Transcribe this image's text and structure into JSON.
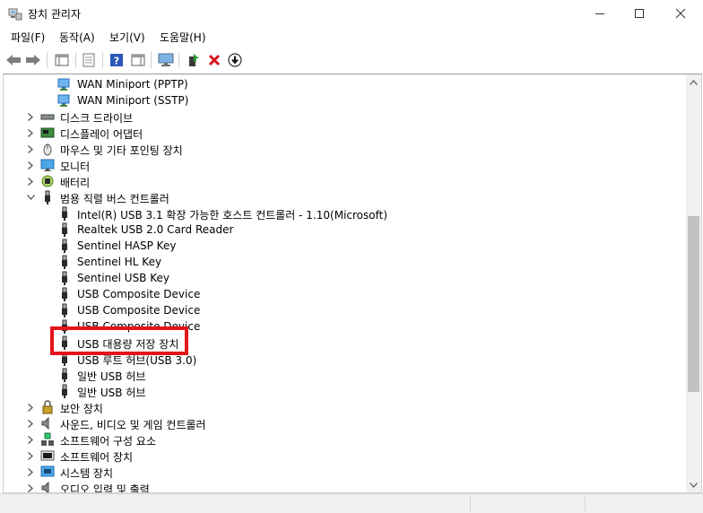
{
  "window": {
    "title": "장치 관리자",
    "icons": {
      "app": "device-manager-icon",
      "minimize": "minimize-icon",
      "maximize": "maximize-icon",
      "close": "close-icon"
    }
  },
  "menu": [
    {
      "label": "파일(F)"
    },
    {
      "label": "동작(A)"
    },
    {
      "label": "보기(V)"
    },
    {
      "label": "도움말(H)"
    }
  ],
  "toolbar": [
    {
      "name": "back-icon"
    },
    {
      "name": "forward-icon"
    },
    {
      "name": "show-hide-console-tree-icon"
    },
    {
      "name": "properties-icon"
    },
    {
      "name": "help-icon"
    },
    {
      "name": "action-pane-icon"
    },
    {
      "name": "scan-hardware-icon"
    },
    {
      "name": "update-driver-icon"
    },
    {
      "name": "uninstall-device-icon"
    },
    {
      "name": "disable-device-icon"
    }
  ],
  "tree": [
    {
      "label": "WAN Miniport (PPTP)",
      "level": 2,
      "icon": "network-adapter-icon"
    },
    {
      "label": "WAN Miniport (SSTP)",
      "level": 2,
      "icon": "network-adapter-icon"
    },
    {
      "label": "디스크 드라이브",
      "level": 1,
      "icon": "disk-drive-icon",
      "expanded": false
    },
    {
      "label": "디스플레이 어댑터",
      "level": 1,
      "icon": "display-adapter-icon",
      "expanded": false
    },
    {
      "label": "마우스 및 기타 포인팅 장치",
      "level": 1,
      "icon": "mouse-icon",
      "expanded": false
    },
    {
      "label": "모니터",
      "level": 1,
      "icon": "monitor-icon",
      "expanded": false
    },
    {
      "label": "배터리",
      "level": 1,
      "icon": "battery-icon",
      "expanded": false
    },
    {
      "label": "범용 직렬 버스 컨트롤러",
      "level": 1,
      "icon": "usb-controller-icon",
      "expanded": true
    },
    {
      "label": "Intel(R) USB 3.1 확장 가능한 호스트 컨트롤러 - 1.10(Microsoft)",
      "level": 2,
      "icon": "usb-device-icon"
    },
    {
      "label": "Realtek USB 2.0 Card Reader",
      "level": 2,
      "icon": "usb-device-icon"
    },
    {
      "label": "Sentinel HASP Key",
      "level": 2,
      "icon": "usb-device-icon"
    },
    {
      "label": "Sentinel HL Key",
      "level": 2,
      "icon": "usb-device-icon"
    },
    {
      "label": "Sentinel USB Key",
      "level": 2,
      "icon": "usb-device-icon"
    },
    {
      "label": "USB Composite Device",
      "level": 2,
      "icon": "usb-device-icon"
    },
    {
      "label": "USB Composite Device",
      "level": 2,
      "icon": "usb-device-icon"
    },
    {
      "label": "USB Composite Device",
      "level": 2,
      "icon": "usb-device-icon"
    },
    {
      "label": "USB 대용량 저장 장치",
      "level": 2,
      "icon": "usb-device-icon",
      "highlighted": true
    },
    {
      "label": "USB 루트 허브(USB 3.0)",
      "level": 2,
      "icon": "usb-device-icon"
    },
    {
      "label": "일반 USB 허브",
      "level": 2,
      "icon": "usb-device-icon"
    },
    {
      "label": "일반 USB 허브",
      "level": 2,
      "icon": "usb-device-icon"
    },
    {
      "label": "보안 장치",
      "level": 1,
      "icon": "security-device-icon",
      "expanded": false
    },
    {
      "label": "사운드, 비디오 및 게임 컨트롤러",
      "level": 1,
      "icon": "sound-icon",
      "expanded": false
    },
    {
      "label": "소프트웨어 구성 요소",
      "level": 1,
      "icon": "software-component-icon",
      "expanded": false
    },
    {
      "label": "소프트웨어 장치",
      "level": 1,
      "icon": "software-device-icon",
      "expanded": false
    },
    {
      "label": "시스템 장치",
      "level": 1,
      "icon": "system-device-icon",
      "expanded": false
    },
    {
      "label": "오디오 입력 및 출력",
      "level": 1,
      "icon": "audio-io-icon",
      "expanded": false
    }
  ],
  "colors": {
    "highlight_border": "#e3141b",
    "toolbar_green": "#2f9e3a",
    "toolbar_red": "#d8141c",
    "help_blue": "#2b59b8"
  }
}
